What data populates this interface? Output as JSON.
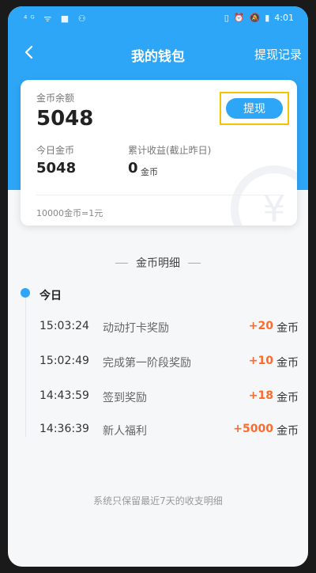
{
  "status": {
    "left": "⁴ᴳ ᯤ ■ ⚇",
    "time": "4:01"
  },
  "nav": {
    "title": "我的钱包",
    "record": "提现记录"
  },
  "balance": {
    "label": "金币余额",
    "value": "5048",
    "withdraw": "提现"
  },
  "today": {
    "label": "今日金币",
    "value": "5048"
  },
  "cumulative": {
    "label": "累计收益(截止昨日)",
    "value": "0",
    "unit": "金币"
  },
  "rate": "10000金币=1元",
  "section": "金币明细",
  "day": "今日",
  "records": [
    {
      "time": "15:03:24",
      "desc": "动动打卡奖励",
      "amount": "+20",
      "unit": "金币"
    },
    {
      "time": "15:02:49",
      "desc": "完成第一阶段奖励",
      "amount": "+10",
      "unit": "金币"
    },
    {
      "time": "14:43:59",
      "desc": "签到奖励",
      "amount": "+18",
      "unit": "金币"
    },
    {
      "time": "14:36:39",
      "desc": "新人福利",
      "amount": "+5000",
      "unit": "金币"
    }
  ],
  "footer": "系统只保留最近7天的收支明细",
  "colors": {
    "primary": "#2ea6f7",
    "accent": "#ff6a2a",
    "highlight": "#f5c400"
  }
}
